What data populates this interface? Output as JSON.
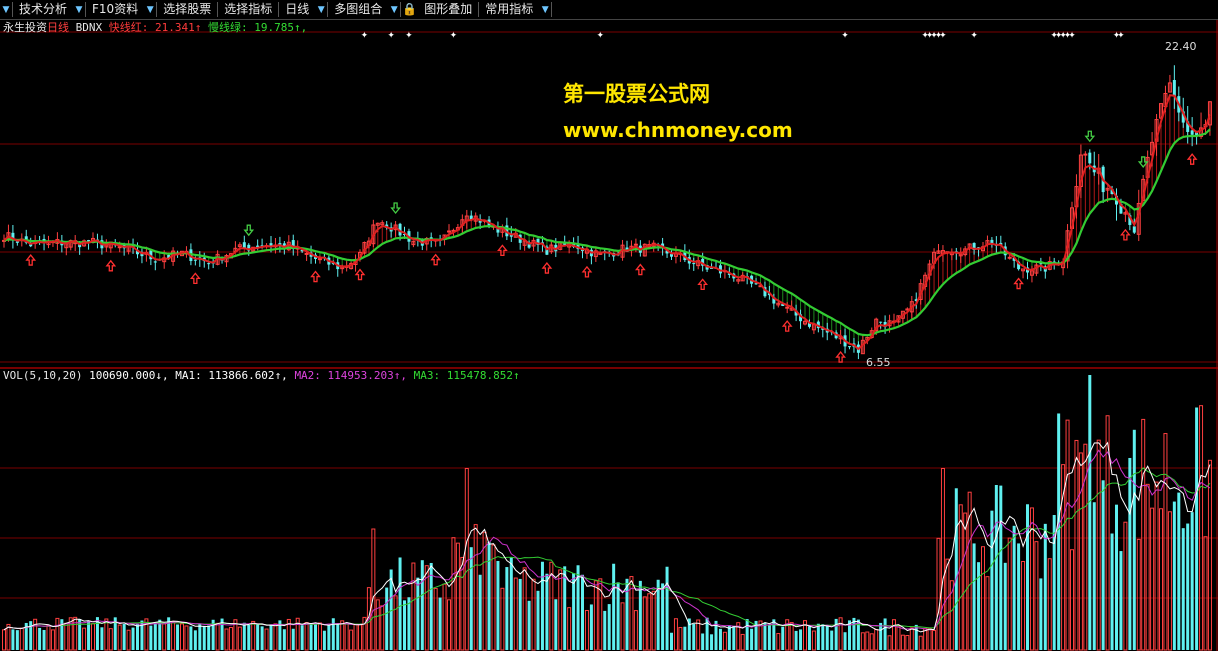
{
  "toolbar": {
    "items": [
      {
        "label": "技术分析",
        "has_menu": true
      },
      {
        "label": "F10资料",
        "has_menu": true
      },
      {
        "label": "选择股票",
        "has_menu": false
      },
      {
        "label": "选择指标",
        "has_menu": false
      },
      {
        "label": "日线",
        "has_menu": true
      },
      {
        "label": "多图组合",
        "has_menu": true
      },
      {
        "label": "图形叠加",
        "has_menu": false
      },
      {
        "label": "常用指标",
        "has_menu": true
      }
    ]
  },
  "price_panel": {
    "indicator_name": "永生投资",
    "period": "日线",
    "formula": "BDNX",
    "fast_line": {
      "label": "快线红: 21.341",
      "arrow": "↑",
      "color": "#ff3b3b"
    },
    "slow_line": {
      "label": "慢线绿: 19.785",
      "arrow": "↑,",
      "color": "#33dd33"
    },
    "high_label": "22.40",
    "low_label": "6.55",
    "y_range": [
      6.0,
      24.5
    ]
  },
  "volume_panel": {
    "title": "VOL(5,10,20)",
    "vol": {
      "label": "100690.000",
      "arrow": "↓,",
      "color": "#ffffff"
    },
    "ma1": {
      "label": "MA1: 113866.602",
      "arrow": "↑,",
      "color": "#ffffff"
    },
    "ma2": {
      "label": "MA2: 114953.203",
      "arrow": "↑,",
      "color": "#dd44dd"
    },
    "ma3": {
      "label": "MA3: 115478.852",
      "arrow": "↑",
      "color": "#33dd33"
    }
  },
  "watermark": {
    "line1": "第一股票公式网",
    "line2": "www.chnmoney.com"
  },
  "colors": {
    "up_candle": "#ff4040",
    "down_candle": "#5ff0f0",
    "fast_line": "#e02020",
    "slow_line": "#33cc33",
    "buy_arrow": "#ff3030",
    "sell_arrow": "#44cc44",
    "grid": "#7a0000",
    "vol_ma1": "#ffffff",
    "vol_ma2": "#cc33cc",
    "vol_ma3": "#33cc33"
  },
  "chart_data": {
    "type": "candlestick+volume",
    "price_anchors": [
      [
        0,
        13.3
      ],
      [
        6,
        12.8
      ],
      [
        12,
        12.9
      ],
      [
        20,
        12.9
      ],
      [
        28,
        12.5
      ],
      [
        34,
        12.0
      ],
      [
        40,
        12.3
      ],
      [
        46,
        11.8
      ],
      [
        52,
        12.5
      ],
      [
        58,
        12.8
      ],
      [
        64,
        12.7
      ],
      [
        70,
        12.0
      ],
      [
        76,
        11.5
      ],
      [
        80,
        12.2
      ],
      [
        84,
        14.2
      ],
      [
        92,
        13.0
      ],
      [
        98,
        12.8
      ],
      [
        104,
        14.6
      ],
      [
        110,
        13.7
      ],
      [
        116,
        13.1
      ],
      [
        122,
        12.5
      ],
      [
        128,
        12.8
      ],
      [
        134,
        12.2
      ],
      [
        140,
        12.6
      ],
      [
        146,
        12.6
      ],
      [
        152,
        12.1
      ],
      [
        158,
        11.5
      ],
      [
        164,
        11.1
      ],
      [
        170,
        10.3
      ],
      [
        176,
        9.2
      ],
      [
        182,
        8.3
      ],
      [
        188,
        7.6
      ],
      [
        192,
        7.0
      ],
      [
        196,
        8.6
      ],
      [
        200,
        8.4
      ],
      [
        204,
        9.4
      ],
      [
        210,
        12.7
      ],
      [
        216,
        12.5
      ],
      [
        222,
        13.0
      ],
      [
        228,
        11.5
      ],
      [
        234,
        11.5
      ],
      [
        238,
        12.0
      ],
      [
        242,
        18.0
      ],
      [
        246,
        16.4
      ],
      [
        250,
        15.6
      ],
      [
        254,
        13.6
      ],
      [
        258,
        18.5
      ],
      [
        262,
        21.5
      ],
      [
        266,
        19.0
      ],
      [
        268,
        18.7
      ],
      [
        270,
        19.2
      ],
      [
        271,
        20.5
      ]
    ],
    "markers": {
      "buy_bars": [
        6,
        24,
        43,
        70,
        80,
        97,
        112,
        122,
        131,
        143,
        157,
        176,
        188,
        228,
        252,
        267
      ],
      "sell_bars": [
        55,
        88,
        244,
        256
      ],
      "top_ticks": [
        81,
        87,
        91,
        101,
        134,
        189,
        207,
        208,
        209,
        210,
        211,
        218,
        236,
        237,
        238,
        239,
        240,
        250,
        251
      ]
    }
  }
}
